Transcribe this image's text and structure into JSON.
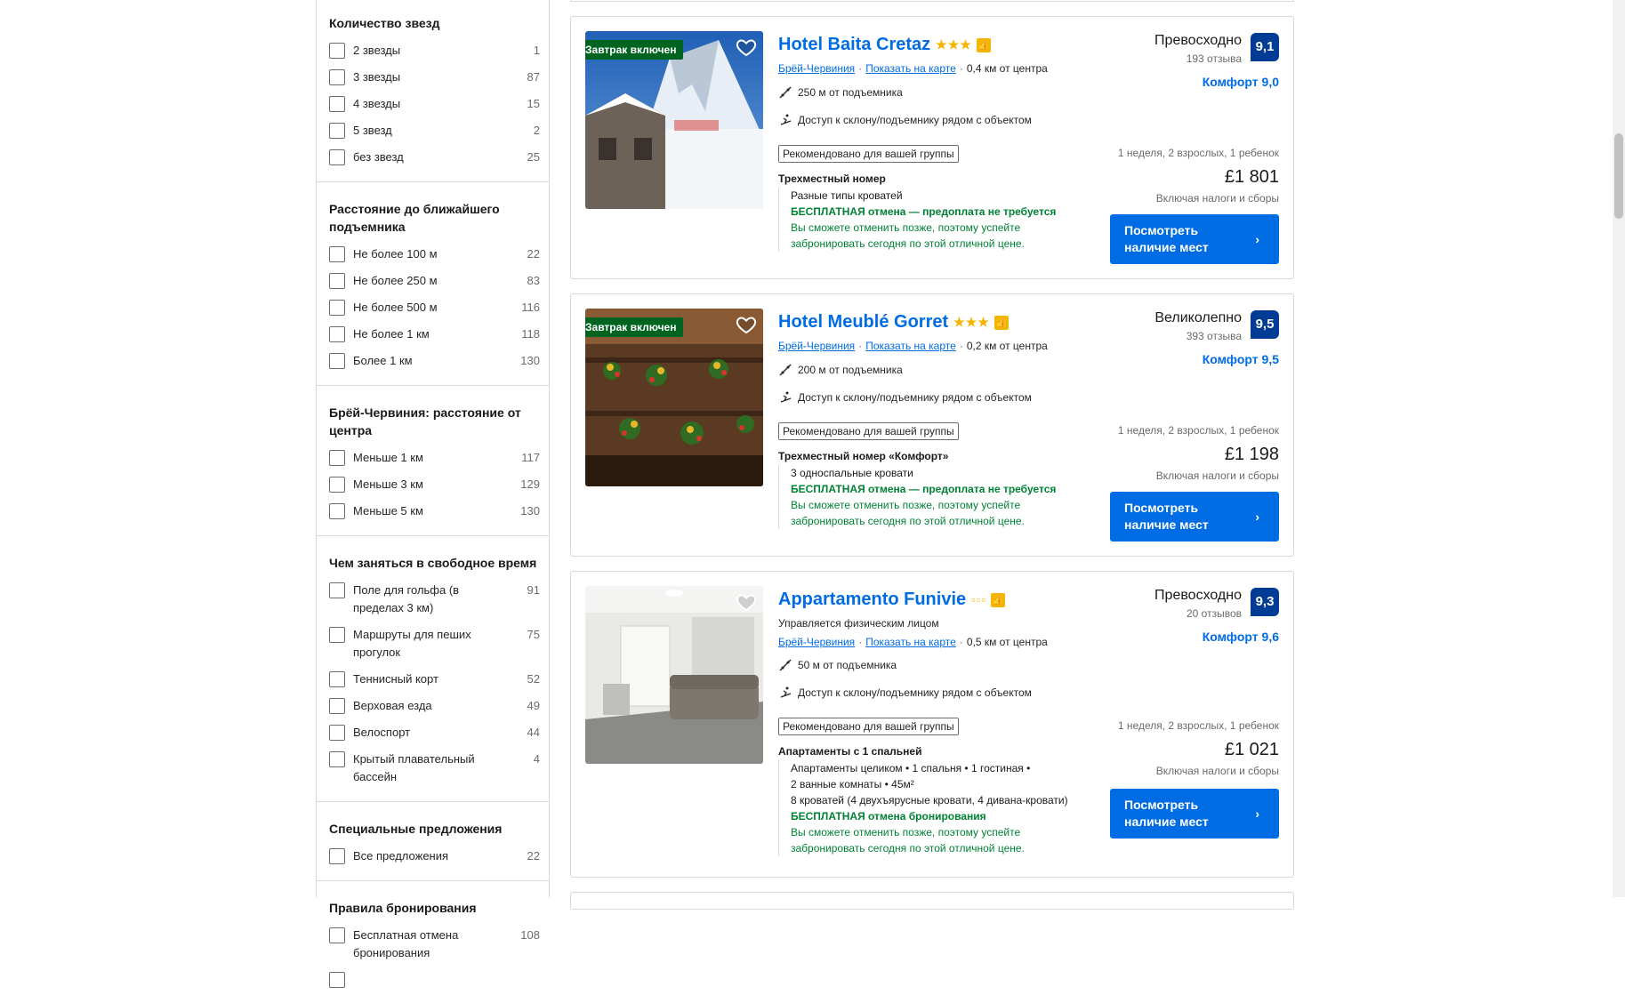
{
  "filters": [
    {
      "title": "Количество звезд",
      "items": [
        {
          "label": "2 звезды",
          "count": "1"
        },
        {
          "label": "3 звезды",
          "count": "87"
        },
        {
          "label": "4 звезды",
          "count": "15"
        },
        {
          "label": "5 звезд",
          "count": "2"
        },
        {
          "label": "без звезд",
          "count": "25"
        }
      ]
    },
    {
      "title": "Расстояние до ближайшего подъемника",
      "items": [
        {
          "label": "Не более 100 м",
          "count": "22"
        },
        {
          "label": "Не более 250 м",
          "count": "83"
        },
        {
          "label": "Не более 500 м",
          "count": "116"
        },
        {
          "label": "Не более 1 км",
          "count": "118"
        },
        {
          "label": "Более 1 км",
          "count": "130"
        }
      ]
    },
    {
      "title": "Брёй-Червиния: расстояние от центра",
      "items": [
        {
          "label": "Меньше 1 км",
          "count": "117"
        },
        {
          "label": "Меньше 3 км",
          "count": "129"
        },
        {
          "label": "Меньше 5 км",
          "count": "130"
        }
      ]
    },
    {
      "title": "Чем заняться в свободное время",
      "items": [
        {
          "label": "Поле для гольфа (в пределах 3 км)",
          "count": "91"
        },
        {
          "label": "Маршруты для пеших прогулок",
          "count": "75"
        },
        {
          "label": "Теннисный корт",
          "count": "52"
        },
        {
          "label": "Верховая езда",
          "count": "49"
        },
        {
          "label": "Велоспорт",
          "count": "44"
        },
        {
          "label": "Крытый плавательный бассейн",
          "count": "4"
        }
      ]
    },
    {
      "title": "Специальные предложения",
      "items": [
        {
          "label": "Все предложения",
          "count": "22"
        }
      ]
    },
    {
      "title": "Правила бронирования",
      "items": [
        {
          "label": "Бесплатная отмена бронирования",
          "count": "108"
        }
      ]
    }
  ],
  "hotels": [
    {
      "badge": "Завтрак включен",
      "name": "Hotel Baita Cretaz",
      "stars": "★★★",
      "managed": "",
      "town": "Брёй-Червиния",
      "map_link": "Показать на карте",
      "distance": "0,4 км от центра",
      "lift": "250 м от подъемника",
      "ski_access": "Доступ к склону/подъемнику рядом с объектом",
      "recommended": "Рекомендовано для вашей группы",
      "room": "Трехместный номер",
      "beds": "Разные типы кроватей",
      "beds2": "",
      "beds3": "",
      "cancel": "БЕСПЛАТНАЯ отмена — предоплата не требуется",
      "cancel_note": "Вы сможете отменить позже, поэтому успейте забронировать сегодня по этой отличной цене.",
      "score_word": "Превосходно",
      "reviews": "193 отзыва",
      "score": "9,1",
      "comfort": "Комфорт 9,0",
      "stay": "1 неделя, 2 взрослых, 1 ребенок",
      "price": "£1 801",
      "tax": "Включая налоги и сборы",
      "button": "Посмотреть наличие мест"
    },
    {
      "badge": "Завтрак включен",
      "name": "Hotel Meublé Gorret",
      "stars": "★★★",
      "managed": "",
      "town": "Брёй-Червиния",
      "map_link": "Показать на карте",
      "distance": "0,2 км от центра",
      "lift": "200 м от подъемника",
      "ski_access": "Доступ к склону/подъемнику рядом с объектом",
      "recommended": "Рекомендовано для вашей группы",
      "room": "Трехместный номер «Комфорт»",
      "beds": "3 односпальные кровати",
      "beds2": "",
      "beds3": "",
      "cancel": "БЕСПЛАТНАЯ отмена — предоплата не требуется",
      "cancel_note": "Вы сможете отменить позже, поэтому успейте забронировать сегодня по этой отличной цене.",
      "score_word": "Великолепно",
      "reviews": "393 отзыва",
      "score": "9,5",
      "comfort": "Комфорт 9,5",
      "stay": "1 неделя, 2 взрослых, 1 ребенок",
      "price": "£1 198",
      "tax": "Включая налоги и сборы",
      "button": "Посмотреть наличие мест"
    },
    {
      "badge": "",
      "name": "Appartamento Funivie",
      "stars": "▫▫▫",
      "managed": "Управляется физическим лицом",
      "town": "Брёй-Червиния",
      "map_link": "Показать на карте",
      "distance": "0,5 км от центра",
      "lift": "50 м от подъемника",
      "ski_access": "Доступ к склону/подъемнику рядом с объектом",
      "recommended": "Рекомендовано для вашей группы",
      "room": "Апартаменты с 1 спальней",
      "beds": "Апартаменты целиком • 1 спальня • 1 гостиная •",
      "beds2": "2 ванные комнаты • 45м²",
      "beds3": "8 кроватей (4 двухъярусные кровати, 4 дивана-кровати)",
      "cancel": "БЕСПЛАТНАЯ отмена бронирования",
      "cancel_note": "Вы сможете отменить позже, поэтому успейте забронировать сегодня по этой отличной цене.",
      "score_word": "Превосходно",
      "reviews": "20 отзывов",
      "score": "9,3",
      "comfort": "Комфорт 9,6",
      "stay": "1 неделя, 2 взрослых, 1 ребенок",
      "price": "£1 021",
      "tax": "Включая налоги и сборы",
      "button": "Посмотреть наличие мест"
    }
  ]
}
